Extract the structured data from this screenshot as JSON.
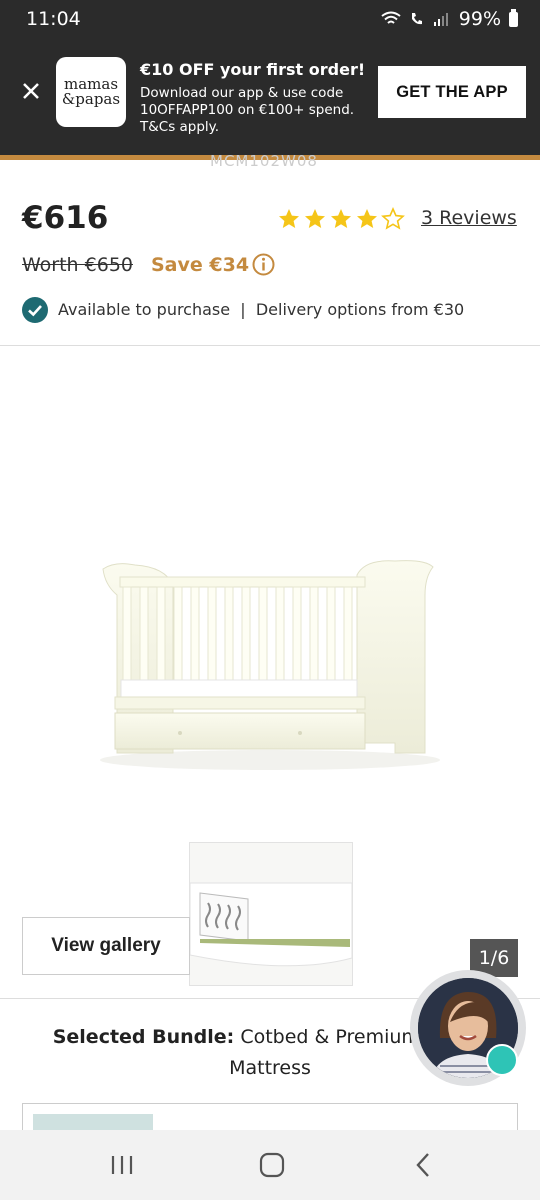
{
  "status": {
    "time": "11:04",
    "battery": "99%"
  },
  "banner": {
    "logo_line1": "mamas",
    "logo_line2": "&papas",
    "title": "€10 OFF your first order!",
    "desc": "Download our app & use code 10OFFAPP100 on €100+ spend. T&Cs apply.",
    "cta": "GET THE APP"
  },
  "product": {
    "sku_partial": "MCM102W08",
    "price": "€616",
    "rating": 4,
    "rating_max": 5,
    "reviews_label": "3 Reviews",
    "worth": "Worth €650",
    "save": "Save €34",
    "availability": "Available to purchase",
    "separator": "|",
    "delivery": "Delivery options from €30"
  },
  "gallery": {
    "view_label": "View gallery",
    "counter": "1/6"
  },
  "bundle": {
    "prefix": "Selected Bundle:",
    "name": "Cotbed & Premium Spring Mattress"
  },
  "colors": {
    "accent": "#c48a3f",
    "dark": "#2b2b2b",
    "star": "#f5c518",
    "check": "#1e6a72",
    "chat_dot": "#2ec4b6"
  }
}
